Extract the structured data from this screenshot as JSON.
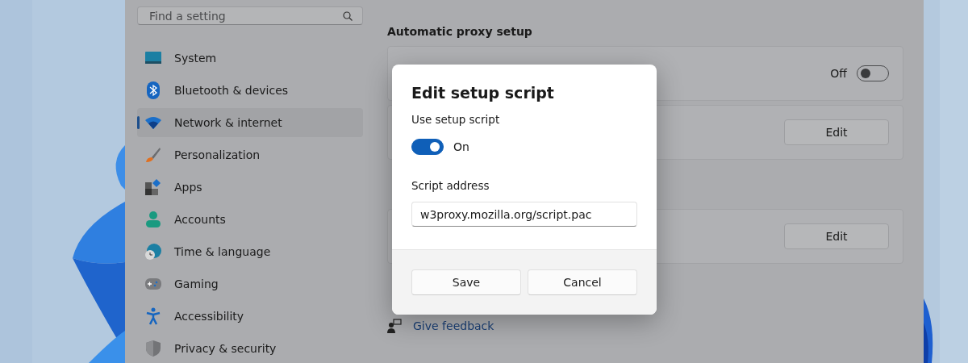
{
  "search": {
    "placeholder": "Find a setting"
  },
  "nav": [
    {
      "label": "System",
      "selected": false
    },
    {
      "label": "Bluetooth & devices",
      "selected": false
    },
    {
      "label": "Network & internet",
      "selected": true
    },
    {
      "label": "Personalization",
      "selected": false
    },
    {
      "label": "Apps",
      "selected": false
    },
    {
      "label": "Accounts",
      "selected": false
    },
    {
      "label": "Time & language",
      "selected": false
    },
    {
      "label": "Gaming",
      "selected": false
    },
    {
      "label": "Accessibility",
      "selected": false
    },
    {
      "label": "Privacy & security",
      "selected": false
    }
  ],
  "sections": [
    {
      "title": "Automatic proxy setup",
      "cards": [
        {
          "kind": "toggle",
          "state_label": "Off",
          "on": false
        },
        {
          "kind": "button",
          "button": "Edit"
        }
      ]
    },
    {
      "cards": [
        {
          "kind": "button",
          "button": "Edit"
        }
      ]
    }
  ],
  "links": [
    {
      "label": "Give feedback"
    }
  ],
  "dialog": {
    "title": "Edit setup script",
    "toggle_label": "Use setup script",
    "toggle": {
      "on": true,
      "state_label": "On"
    },
    "field_label": "Script address",
    "field_value": "w3proxy.mozilla.org/script.pac",
    "buttons": [
      "Save",
      "Cancel"
    ]
  }
}
